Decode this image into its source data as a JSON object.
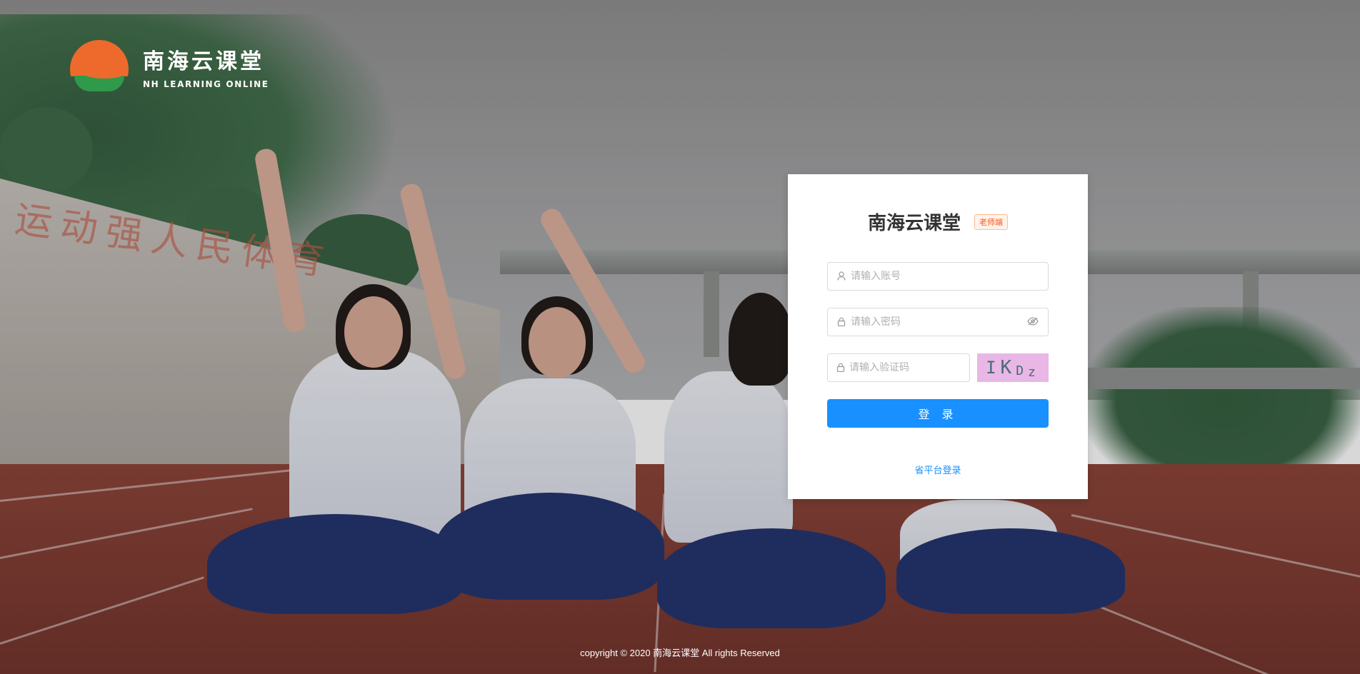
{
  "brand": {
    "name_cn": "南海云课堂",
    "name_en": "NH LEARNING ONLINE"
  },
  "background": {
    "stand_text": "运动强人民体育"
  },
  "login": {
    "title": "南海云课堂",
    "role_badge": "老师端",
    "account_placeholder": "请输入账号",
    "password_placeholder": "请输入密码",
    "captcha_placeholder": "请输入验证码",
    "captcha_chars": [
      "I",
      "K",
      "D",
      "z"
    ],
    "submit_label": "登 录",
    "province_login_link": "省平台登录"
  },
  "footer": {
    "copyright": "copyright © 2020 南海云课堂 All rights Reserved"
  },
  "colors": {
    "primary": "#1890ff",
    "badge_text": "#fa541c",
    "logo_orange": "#ee6a2c",
    "logo_green": "#2f9a4a",
    "captcha_bg": "#e8b7e6"
  },
  "icons": {
    "account": "user-icon",
    "password": "lock-icon",
    "captcha": "lock-icon",
    "toggle_password": "eye-invisible-icon"
  }
}
